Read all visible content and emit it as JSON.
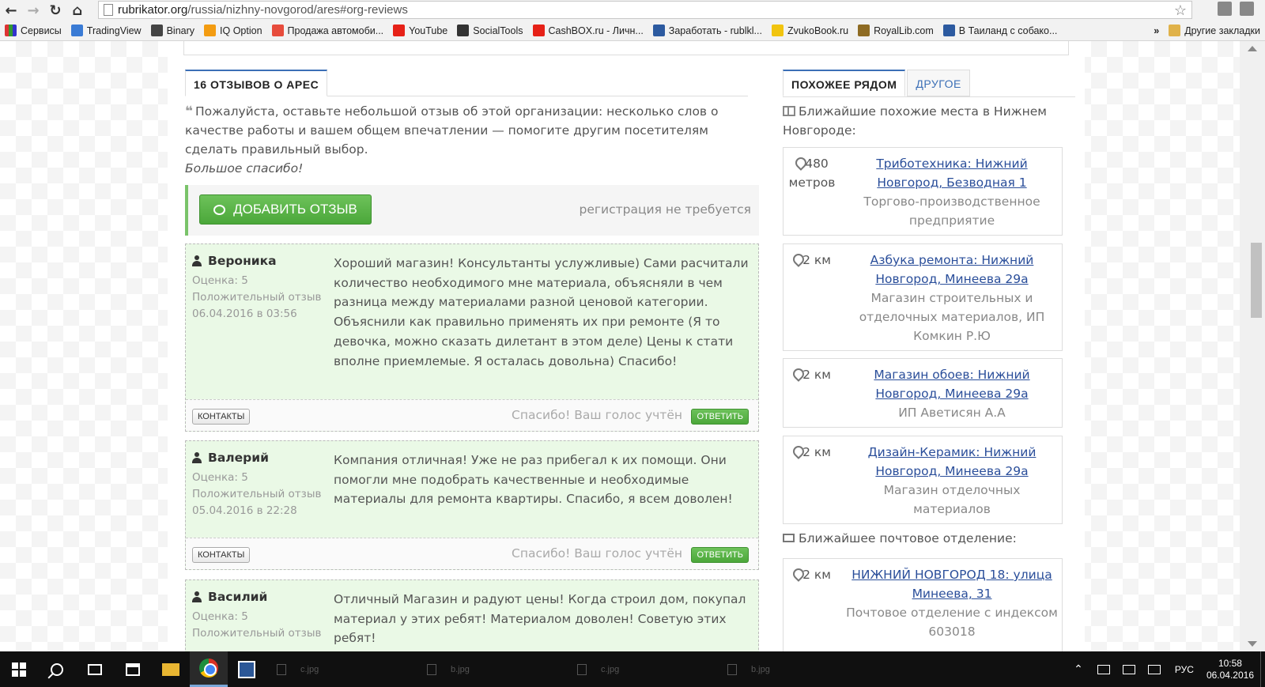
{
  "browser": {
    "url_host": "rubrikator.org",
    "url_path": "/russia/nizhny-novgorod/ares#org-reviews"
  },
  "bookmarks": [
    {
      "label": "Сервисы",
      "color": "#d33"
    },
    {
      "label": "TradingView",
      "color": "#3a7bd5"
    },
    {
      "label": "Binary",
      "color": "#444"
    },
    {
      "label": "IQ Option",
      "color": "#f39c12"
    },
    {
      "label": "Продажа автомоби...",
      "color": "#e74c3c"
    },
    {
      "label": "YouTube",
      "color": "#e62117"
    },
    {
      "label": "SocialTools",
      "color": "#333"
    },
    {
      "label": "CashBOX.ru - Личн...",
      "color": "#e62117"
    },
    {
      "label": "Заработать - rublkl...",
      "color": "#2c5aa0"
    },
    {
      "label": "ZvukoBook.ru",
      "color": "#f1c40f"
    },
    {
      "label": "RoyalLib.com",
      "color": "#8e6b23"
    },
    {
      "label": "В Таиланд с собако...",
      "color": "#2c5aa0"
    }
  ],
  "bookmarks_more": "»",
  "bookmarks_other": "Другие закладки",
  "tabs_left": {
    "active": "16 отзывов о АРЕС"
  },
  "tabs_right": {
    "active": "Похожее рядом",
    "inactive": "Другое"
  },
  "prompt": {
    "quote": "❝",
    "text": "Пожалуйста, оставьте небольшой отзыв об этой организации: несколько слов о качестве работы и вашем общем впечатлении — помогите другим посетителям сделать правильный выбор.",
    "thanks": "Большое спасибо!"
  },
  "add_review": {
    "button": "Добавить отзыв",
    "note": "регистрация не требуется"
  },
  "review_footer": {
    "contacts": "Контакты",
    "vote_note": "Спасибо! Ваш голос учтён",
    "reply": "Ответить"
  },
  "reviews": [
    {
      "author": "Вероника",
      "rating": "Оценка: 5",
      "kind": "Положительный отзыв",
      "date": "06.04.2016 в 03:56",
      "text": "Хороший магазин! Консультанты услужливые) Сами расчитали количество необходимого мне материала, объясняли в чем разница между материалами разной ценовой категории. Объяснили как правильно применять их при ремонте (Я то девочка, можно сказать дилетант в этом деле) Цены к стати вполне приемлемые. Я осталась довольна) Спасибо!"
    },
    {
      "author": "Валерий",
      "rating": "Оценка: 5",
      "kind": "Положительный отзыв",
      "date": "05.04.2016 в 22:28",
      "text": "Компания отличная! Уже не раз прибегал к их помощи. Они помогли мне подобрать качественные и необходимые материалы для ремонта квартиры. Спасибо, я всем доволен!"
    },
    {
      "author": "Василий",
      "rating": "Оценка: 5",
      "kind": "Положительный отзыв",
      "date": "",
      "text": "Отличный Магазин и радуют цены! Когда строил дом, покупал материал у этих ребят! Материалом доволен! Советую этих ребят!"
    }
  ],
  "near": {
    "title": "Ближайшие похожие места в Нижнем Новгороде:",
    "places": [
      {
        "dist": "480 метров",
        "name": "Триботехника: Нижний Новгород, Безводная 1",
        "desc": "Торгово-производственное предприятие"
      },
      {
        "dist": "2 км",
        "name": "Азбука ремонта: Нижний Новгород, Минеева 29а",
        "desc": "Магазин строительных и отделочных материалов, ИП Комкин Р.Ю"
      },
      {
        "dist": "2 км",
        "name": "Магазин обоев: Нижний Новгород, Минеева 29а",
        "desc": "ИП Аветисян А.А"
      },
      {
        "dist": "2 км",
        "name": "Дизайн-Керамик: Нижний Новгород, Минеева 29а",
        "desc": "Магазин отделочных материалов"
      }
    ],
    "post_title": "Ближайшее почтовое отделение:",
    "post": {
      "dist": "2 км",
      "name": "НИЖНИЙ НОВГОРОД 18: улица Минеева, 31",
      "desc": "Почтовое отделение с индексом 603018"
    }
  },
  "taskbar": {
    "thumbs": [
      "a.jpg",
      "c.jpg",
      "b.jpg",
      "c.jpg",
      "b.jpg"
    ],
    "lang": "РУС",
    "time": "10:58",
    "date": "06.04.2016"
  }
}
